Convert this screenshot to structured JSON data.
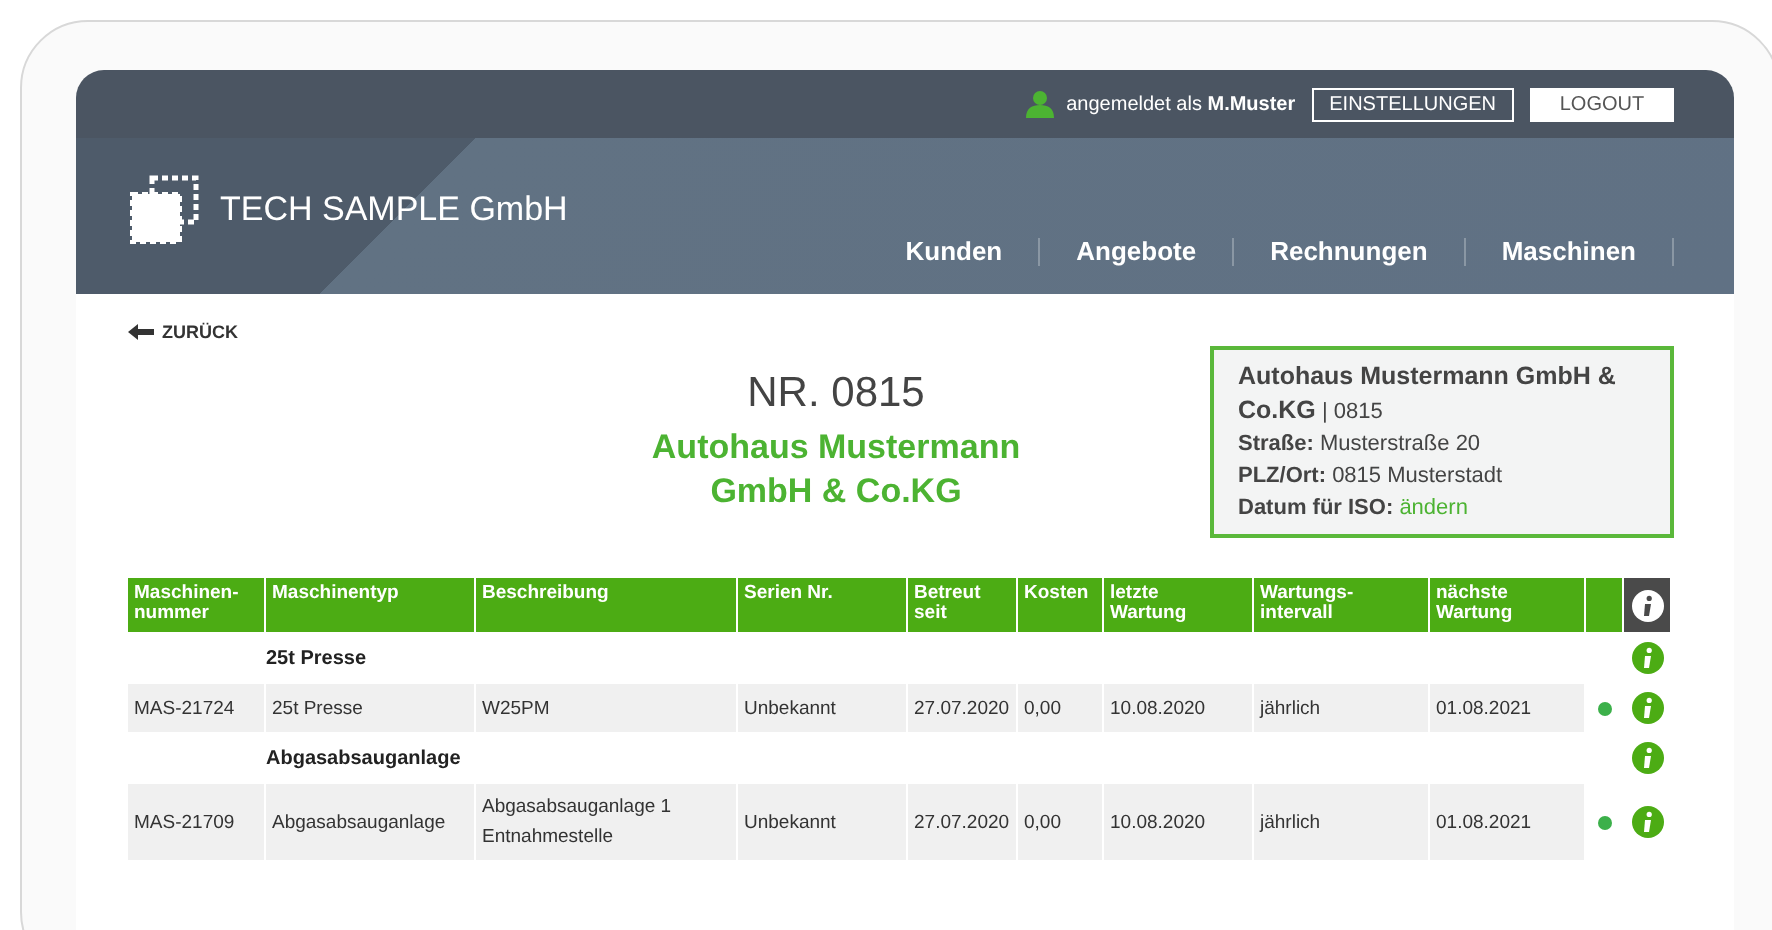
{
  "top_bar": {
    "user_label": "angemeldet als",
    "user_name": "M.Muster",
    "buttons": [
      {
        "label": "EINSTELLUNGEN",
        "kind": "outline"
      },
      {
        "label": "LOGOUT",
        "kind": "filled"
      }
    ]
  },
  "header": {
    "brand": "TECH SAMPLE GmbH",
    "nav": [
      "Kunden",
      "Angebote",
      "Rechnungen",
      "Maschinen"
    ]
  },
  "back_link": "ZURÜCK",
  "title": "NR. 0815",
  "customer_name": "Autohaus Mustermann GmbH & Co.KG",
  "address_card": {
    "name": "Autohaus Mustermann GmbH & Co.KG",
    "number": "| 0815",
    "lines": [
      {
        "label": "Straße:",
        "value": "Musterstraße 20",
        "kind": "text"
      },
      {
        "label": "PLZ/Ort:",
        "value": "0815 Musterstadt",
        "kind": "text"
      },
      {
        "label": "Datum für ISO:",
        "value": "ändern",
        "kind": "link"
      }
    ]
  },
  "table": {
    "columns": [
      "Maschinen-\nnummer",
      "Maschinentyp",
      "Beschreibung",
      "Serien Nr.",
      "Betreut\nseit",
      "Kosten",
      "letzte\nWartung",
      "Wartungs-\nintervall",
      "nächste\nWartung"
    ],
    "rows": [
      {
        "kind": "group",
        "title": "25t Presse"
      },
      {
        "kind": "item",
        "cells": [
          "MAS-21724",
          "25t Presse",
          "W25PM",
          "Unbekannt",
          "27.07.2020",
          "0,00",
          "10.08.2020",
          "jährlich",
          "01.08.2021"
        ],
        "color": "#3cb04a"
      },
      {
        "kind": "group",
        "title": "Abgasabsauganlage"
      },
      {
        "kind": "item",
        "cells": [
          "MAS-21709",
          "Abgasabsauganlage",
          "Abgasabsauganlage 1\nEntnahmestelle",
          "Unbekannt",
          "27.07.2020",
          "0,00",
          "10.08.2020",
          "jährlich",
          "01.08.2021"
        ],
        "color": "#3cb04a"
      }
    ]
  }
}
